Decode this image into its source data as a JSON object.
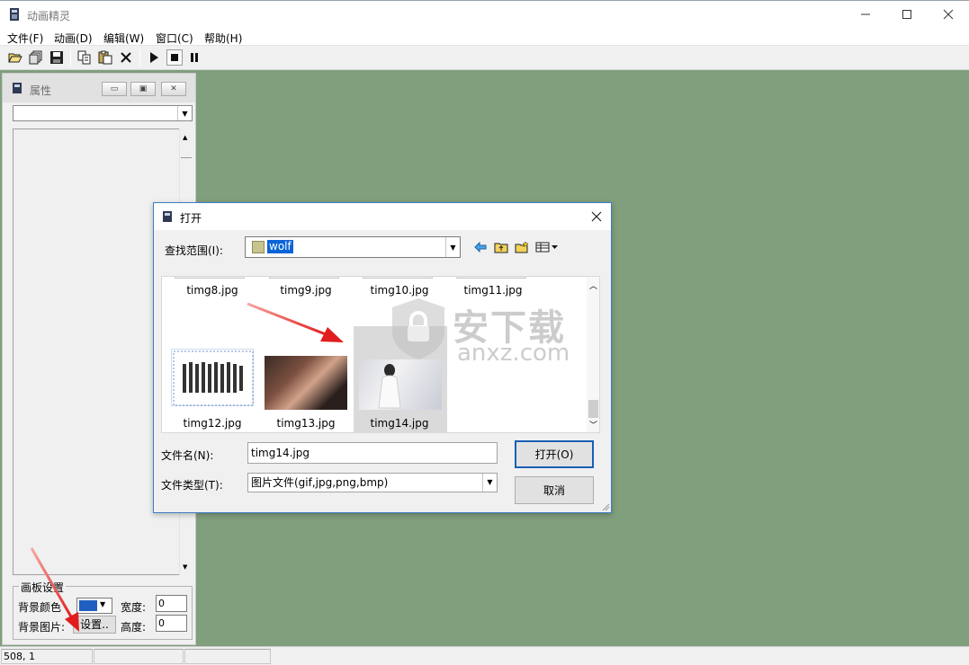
{
  "app": {
    "title": "动画精灵",
    "window_controls": [
      "minimize",
      "maximize",
      "close"
    ]
  },
  "menu": {
    "items": [
      {
        "label": "文件(F)"
      },
      {
        "label": "动画(D)"
      },
      {
        "label": "编辑(W)"
      },
      {
        "label": "窗口(C)"
      },
      {
        "label": "帮助(H)"
      }
    ]
  },
  "toolbar": {
    "buttons": [
      "open-folder-icon",
      "open-multiple-icon",
      "save-icon",
      "copy-icon",
      "paste-icon",
      "delete-icon",
      "play-icon",
      "stop-icon",
      "pause-icon"
    ]
  },
  "properties_panel": {
    "title": "属性",
    "canvas_group_label": "画板设置",
    "bg_color_label": "背景颜色",
    "bg_color": "#1f5fbf",
    "bg_image_label": "背景图片:",
    "set_button_label": "设置..",
    "width_label": "宽度:",
    "width_value": "0",
    "height_label": "高度:",
    "height_value": "0"
  },
  "status_bar": {
    "coords": "508, 1"
  },
  "workspace": {
    "background": "#809f7d"
  },
  "open_dialog": {
    "title": "打开",
    "look_in_label": "查找范围(I):",
    "look_in_value": "wolf",
    "files": [
      {
        "name": "timg8.jpg"
      },
      {
        "name": "timg9.jpg"
      },
      {
        "name": "timg10.jpg"
      },
      {
        "name": "timg11.jpg"
      },
      {
        "name": "timg12.jpg"
      },
      {
        "name": "timg13.jpg"
      },
      {
        "name": "timg14.jpg",
        "selected": true
      }
    ],
    "filename_label": "文件名(N):",
    "filename_value": "timg14.jpg",
    "filetype_label": "文件类型(T):",
    "filetype_value": "图片文件(gif,jpg,png,bmp)",
    "open_button": "打开(O)",
    "cancel_button": "取消"
  },
  "watermark": {
    "cn": "安下载",
    "en": "anxz.com"
  },
  "annotation_color": "#e8201f"
}
